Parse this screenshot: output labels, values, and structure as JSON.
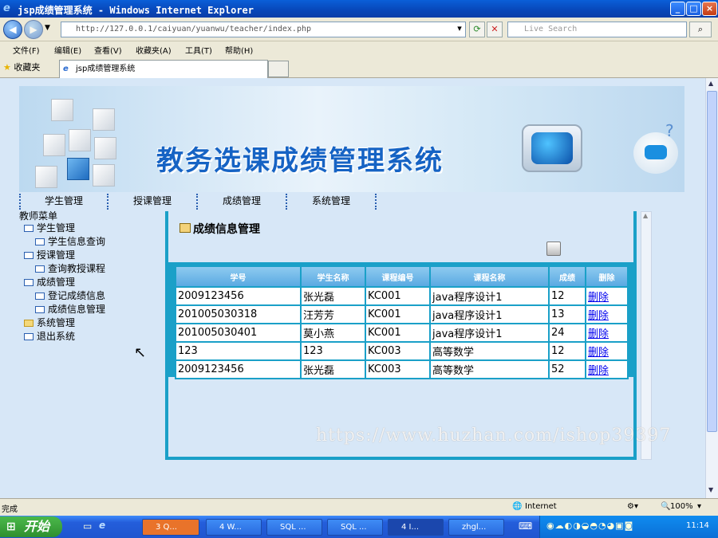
{
  "window": {
    "title": "jsp成绩管理系统 - Windows Internet Explorer",
    "minimize": "_",
    "maximize": "□",
    "close": "×"
  },
  "addressbar": {
    "url": "http://127.0.0.1/caiyuan/yuanwu/teacher/index.php",
    "search_placeholder": "Live Search"
  },
  "menu": [
    "文件(F)",
    "编辑(E)",
    "查看(V)",
    "收藏夹(A)",
    "工具(T)",
    "帮助(H)"
  ],
  "favorites_label": "收藏夹",
  "tab": {
    "label": "jsp成绩管理系统"
  },
  "banner": {
    "title": "教务选课成绩管理系统"
  },
  "nav": [
    "学生管理",
    "授课管理",
    "成绩管理",
    "系统管理"
  ],
  "sidebar": {
    "heading": "教师菜单",
    "items": [
      {
        "label": "学生管理",
        "level": 1,
        "icon": "window-icon"
      },
      {
        "label": "学生信息查询",
        "level": 2,
        "icon": "window-icon"
      },
      {
        "label": "授课管理",
        "level": 1,
        "icon": "window-icon"
      },
      {
        "label": "查询教授课程",
        "level": 2,
        "icon": "window-icon"
      },
      {
        "label": "成绩管理",
        "level": 1,
        "icon": "window-icon"
      },
      {
        "label": "登记成绩信息",
        "level": 2,
        "icon": "window-icon"
      },
      {
        "label": "成绩信息管理",
        "level": 2,
        "icon": "window-icon"
      },
      {
        "label": "系统管理",
        "level": 1,
        "icon": "folder-icon"
      },
      {
        "label": "退出系统",
        "level": 1,
        "icon": "window-icon"
      }
    ]
  },
  "panel": {
    "title": "成绩信息管理",
    "columns": [
      "学号",
      "学生名称",
      "课程编号",
      "课程名称",
      "成绩",
      "删除"
    ],
    "rows": [
      [
        "2009123456",
        "张光磊",
        "KC001",
        "java程序设计1",
        "12",
        "删除"
      ],
      [
        "201005030318",
        "汪芳芳",
        "KC001",
        "java程序设计1",
        "13",
        "删除"
      ],
      [
        "201005030401",
        "莫小燕",
        "KC001",
        "java程序设计1",
        "24",
        "删除"
      ],
      [
        "123",
        "123",
        "KC003",
        "高等数学",
        "12",
        "删除"
      ],
      [
        "2009123456",
        "张光磊",
        "KC003",
        "高等数学",
        "52",
        "删除"
      ]
    ]
  },
  "watermark": "https://www.huzhan.com/ishop39397",
  "status": {
    "left": "完成",
    "zone": "Internet",
    "zoom": "100%"
  },
  "taskbar": {
    "start": "开始",
    "tasks": [
      "3 Q...",
      "4 W...",
      "SQL ...",
      "SQL ...",
      "4 I...",
      "zhgl..."
    ],
    "clock": "11:14"
  }
}
